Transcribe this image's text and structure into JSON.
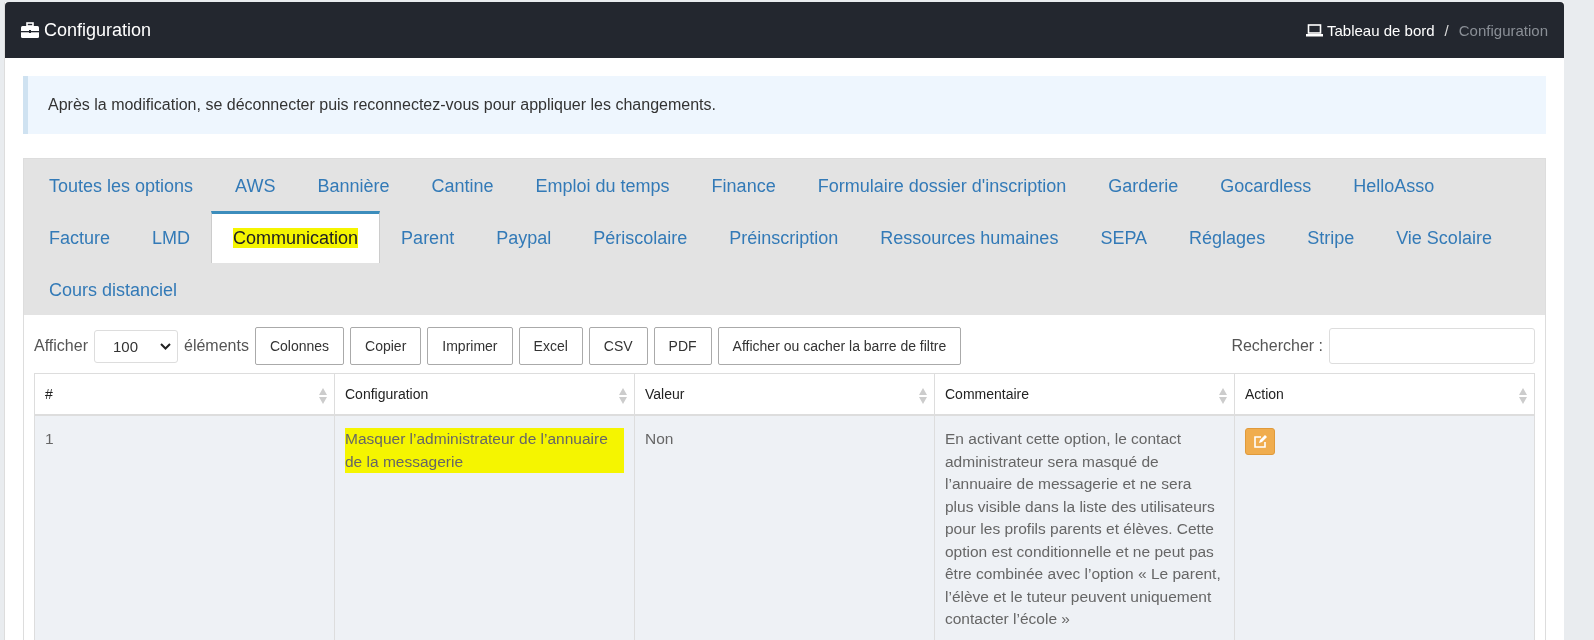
{
  "header": {
    "title": "Configuration",
    "breadcrumb": [
      {
        "label": "Tableau de bord",
        "active": false
      },
      {
        "label": "Configuration",
        "active": true
      }
    ],
    "separator": "/"
  },
  "alert": {
    "text": "Après la modification, se déconnecter puis reconnectez-vous pour appliquer les changements."
  },
  "tabs": [
    {
      "label": "Toutes les options",
      "selected": false,
      "highlighted": false
    },
    {
      "label": "AWS",
      "selected": false,
      "highlighted": false
    },
    {
      "label": "Bannière",
      "selected": false,
      "highlighted": false
    },
    {
      "label": "Cantine",
      "selected": false,
      "highlighted": false
    },
    {
      "label": "Emploi du temps",
      "selected": false,
      "highlighted": false
    },
    {
      "label": "Finance",
      "selected": false,
      "highlighted": false
    },
    {
      "label": "Formulaire dossier d'inscription",
      "selected": false,
      "highlighted": false
    },
    {
      "label": "Garderie",
      "selected": false,
      "highlighted": false
    },
    {
      "label": "Gocardless",
      "selected": false,
      "highlighted": false
    },
    {
      "label": "HelloAsso",
      "selected": false,
      "highlighted": false
    },
    {
      "label": "Facture",
      "selected": false,
      "highlighted": false
    },
    {
      "label": "LMD",
      "selected": false,
      "highlighted": false
    },
    {
      "label": "Communication",
      "selected": true,
      "highlighted": true
    },
    {
      "label": "Parent",
      "selected": false,
      "highlighted": false
    },
    {
      "label": "Paypal",
      "selected": false,
      "highlighted": false
    },
    {
      "label": "Périscolaire",
      "selected": false,
      "highlighted": false
    },
    {
      "label": "Préinscription",
      "selected": false,
      "highlighted": false
    },
    {
      "label": "Ressources humaines",
      "selected": false,
      "highlighted": false
    },
    {
      "label": "SEPA",
      "selected": false,
      "highlighted": false
    },
    {
      "label": "Réglages",
      "selected": false,
      "highlighted": false
    },
    {
      "label": "Stripe",
      "selected": false,
      "highlighted": false
    },
    {
      "label": "Vie Scolaire",
      "selected": false,
      "highlighted": false
    },
    {
      "label": "Cours distanciel",
      "selected": false,
      "highlighted": false
    }
  ],
  "toolbar": {
    "show_label": "Afficher",
    "page_size": "100",
    "items_label": "éléments",
    "buttons": [
      "Colonnes",
      "Copier",
      "Imprimer",
      "Excel",
      "CSV",
      "PDF",
      "Afficher ou cacher la barre de filtre"
    ],
    "search_label": "Rechercher :"
  },
  "table": {
    "columns": [
      "#",
      "Configuration",
      "Valeur",
      "Commentaire",
      "Action"
    ],
    "rows": [
      {
        "cells": [
          {
            "text": "1",
            "highlighted": false
          },
          {
            "text": "Masquer l’administrateur de l’annuaire de la messagerie",
            "highlighted": true
          },
          {
            "text": "Non",
            "highlighted": false
          },
          {
            "text": "En activant cette option, le contact administrateur sera masqué de l’annuaire de messagerie et ne sera plus visible dans la liste des utilisateurs pour les profils parents et élèves. Cette option est conditionnelle et ne peut pas être combinée avec l’option « Le parent, l’élève et le tuteur peuvent uniquement contacter l’école »",
            "highlighted": false
          }
        ]
      }
    ]
  }
}
